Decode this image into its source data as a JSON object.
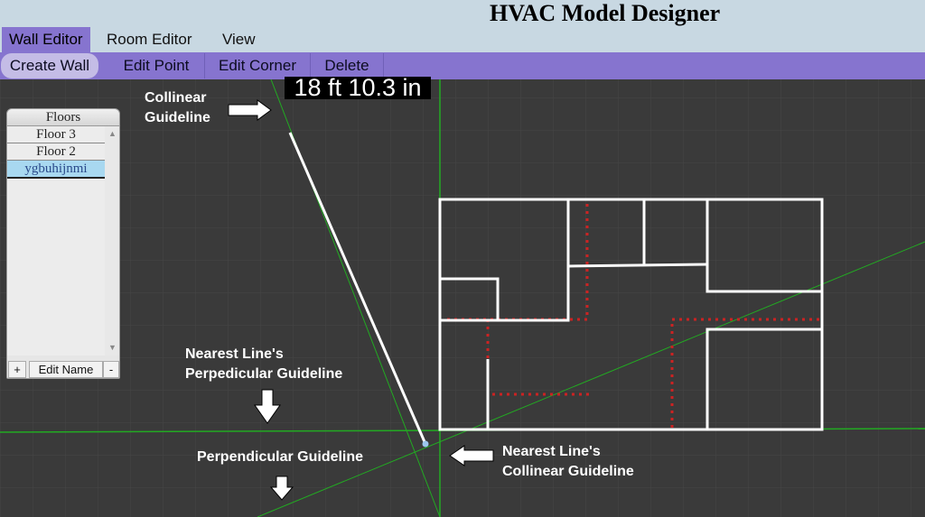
{
  "app": {
    "title": "HVAC Model Designer"
  },
  "menu": {
    "items": [
      {
        "label": "Wall Editor",
        "active": true
      },
      {
        "label": "Room Editor",
        "active": false
      },
      {
        "label": "View",
        "active": false
      }
    ]
  },
  "toolbar": {
    "items": [
      {
        "label": "Create Wall",
        "active": true
      },
      {
        "label": "Edit Point",
        "active": false
      },
      {
        "label": "Edit Corner",
        "active": false
      },
      {
        "label": "Delete",
        "active": false
      }
    ]
  },
  "canvas": {
    "measurement": "18 ft 10.3 in",
    "colors": {
      "background": "#3a3a3a",
      "grid": "#454545",
      "guideline": "#22aa22",
      "wall": "#ffffff",
      "duct": "#cc2222",
      "endpoint": "#9cc6ee"
    }
  },
  "floors": {
    "header": "Floors",
    "items": [
      "Floor 3",
      "Floor 2",
      "ygbuhijnmi"
    ],
    "selected": "ygbuhijnmi",
    "add_label": "+",
    "edit_label": "Edit Name",
    "remove_label": "-"
  },
  "annotations": {
    "collinear": [
      "Collinear",
      "Guideline"
    ],
    "nearest_perp": [
      "Nearest Line's",
      "Perpedicular Guideline"
    ],
    "perpendicular": "Perpendicular Guideline",
    "nearest_collinear": [
      "Nearest Line's",
      "Collinear Guideline"
    ]
  }
}
